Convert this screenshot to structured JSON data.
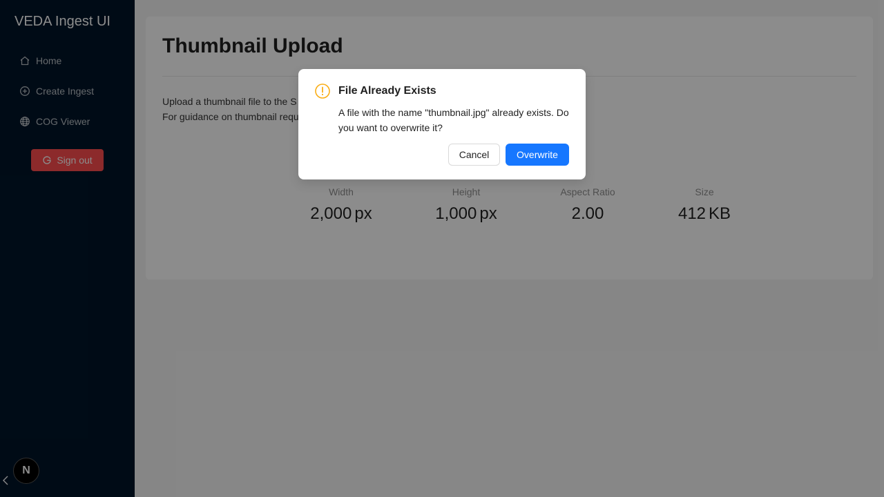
{
  "sidebar": {
    "app_title": "VEDA Ingest UI",
    "items": [
      {
        "label": "Home",
        "icon": "home-icon"
      },
      {
        "label": "Create Ingest",
        "icon": "plus-circle-icon"
      },
      {
        "label": "COG Viewer",
        "icon": "globe-icon"
      }
    ],
    "signout_label": "Sign out",
    "signout_color": "#ff4d4f",
    "dev_badge": "N",
    "background": "#001529"
  },
  "main": {
    "title": "Thumbnail Upload",
    "description_line1": "Upload a thumbnail file to the S",
    "description_line2": "For guidance on thumbnail requ",
    "stats": [
      {
        "title": "Width",
        "value": "2,000",
        "suffix": "px"
      },
      {
        "title": "Height",
        "value": "1,000",
        "suffix": "px"
      },
      {
        "title": "Aspect Ratio",
        "value": "2.00",
        "suffix": ""
      },
      {
        "title": "Size",
        "value": "412",
        "suffix": "KB"
      }
    ]
  },
  "modal": {
    "title": "File Already Exists",
    "content": "A file with the name \"thumbnail.jpg\" already exists. Do you want to overwrite it?",
    "cancel_label": "Cancel",
    "ok_label": "Overwrite",
    "icon": "exclamation-circle-icon",
    "icon_color": "#faad14",
    "primary_color": "#1677ff"
  }
}
